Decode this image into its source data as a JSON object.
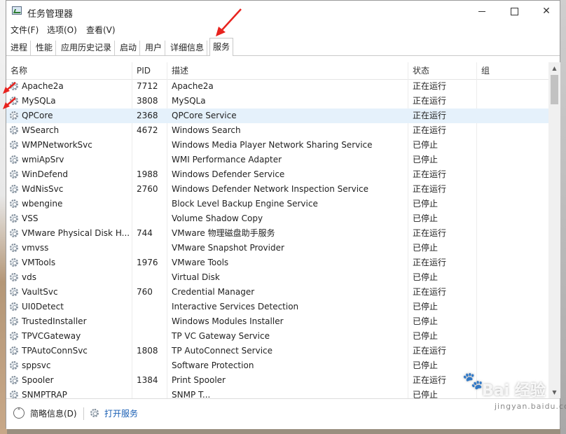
{
  "window": {
    "title": "任务管理器",
    "minimize_label": "—",
    "close_label": "✕"
  },
  "menu": [
    "文件(F)",
    "选项(O)",
    "查看(V)"
  ],
  "tabs": [
    "进程",
    "性能",
    "应用历史记录",
    "启动",
    "用户",
    "详细信息",
    "服务"
  ],
  "active_tab": "服务",
  "columns": {
    "name": "名称",
    "pid": "PID",
    "desc": "描述",
    "status": "状态",
    "group": "组"
  },
  "services": [
    {
      "name": "Apache2a",
      "pid": "7712",
      "desc": "Apache2a",
      "status": "正在运行"
    },
    {
      "name": "MySQLa",
      "pid": "3808",
      "desc": "MySQLa",
      "status": "正在运行"
    },
    {
      "name": "QPCore",
      "pid": "2368",
      "desc": "QPCore Service",
      "status": "正在运行"
    },
    {
      "name": "WSearch",
      "pid": "4672",
      "desc": "Windows Search",
      "status": "正在运行"
    },
    {
      "name": "WMPNetworkSvc",
      "pid": "",
      "desc": "Windows Media Player Network Sharing Service",
      "status": "已停止"
    },
    {
      "name": "wmiApSrv",
      "pid": "",
      "desc": "WMI Performance Adapter",
      "status": "已停止"
    },
    {
      "name": "WinDefend",
      "pid": "1988",
      "desc": "Windows Defender Service",
      "status": "正在运行"
    },
    {
      "name": "WdNisSvc",
      "pid": "2760",
      "desc": "Windows Defender Network Inspection Service",
      "status": "正在运行"
    },
    {
      "name": "wbengine",
      "pid": "",
      "desc": "Block Level Backup Engine Service",
      "status": "已停止"
    },
    {
      "name": "VSS",
      "pid": "",
      "desc": "Volume Shadow Copy",
      "status": "已停止"
    },
    {
      "name": "VMware Physical Disk H...",
      "pid": "744",
      "desc": "VMware 物理磁盘助手服务",
      "status": "正在运行"
    },
    {
      "name": "vmvss",
      "pid": "",
      "desc": "VMware Snapshot Provider",
      "status": "已停止"
    },
    {
      "name": "VMTools",
      "pid": "1976",
      "desc": "VMware Tools",
      "status": "正在运行"
    },
    {
      "name": "vds",
      "pid": "",
      "desc": "Virtual Disk",
      "status": "已停止"
    },
    {
      "name": "VaultSvc",
      "pid": "760",
      "desc": "Credential Manager",
      "status": "正在运行"
    },
    {
      "name": "UI0Detect",
      "pid": "",
      "desc": "Interactive Services Detection",
      "status": "已停止"
    },
    {
      "name": "TrustedInstaller",
      "pid": "",
      "desc": "Windows Modules Installer",
      "status": "已停止"
    },
    {
      "name": "TPVCGateway",
      "pid": "",
      "desc": "TP VC Gateway Service",
      "status": "已停止"
    },
    {
      "name": "TPAutoConnSvc",
      "pid": "1808",
      "desc": "TP AutoConnect Service",
      "status": "正在运行"
    },
    {
      "name": "sppsvc",
      "pid": "",
      "desc": "Software Protection",
      "status": "已停止"
    },
    {
      "name": "Spooler",
      "pid": "1384",
      "desc": "Print Spooler",
      "status": "正在运行"
    },
    {
      "name": "SNMPTRAP",
      "pid": "",
      "desc": "SNMP T...",
      "status": "已停止"
    }
  ],
  "selected_service": "QPCore",
  "footer": {
    "collapse_label": "简略信息(D)",
    "open_services_label": "打开服务"
  },
  "watermark": {
    "brand": "Bai 经验",
    "url": "jingyan.baidu.com"
  },
  "colors": {
    "selection": "#e5f1fb",
    "link": "#1a5fb4",
    "annotation": "#e8231e"
  }
}
